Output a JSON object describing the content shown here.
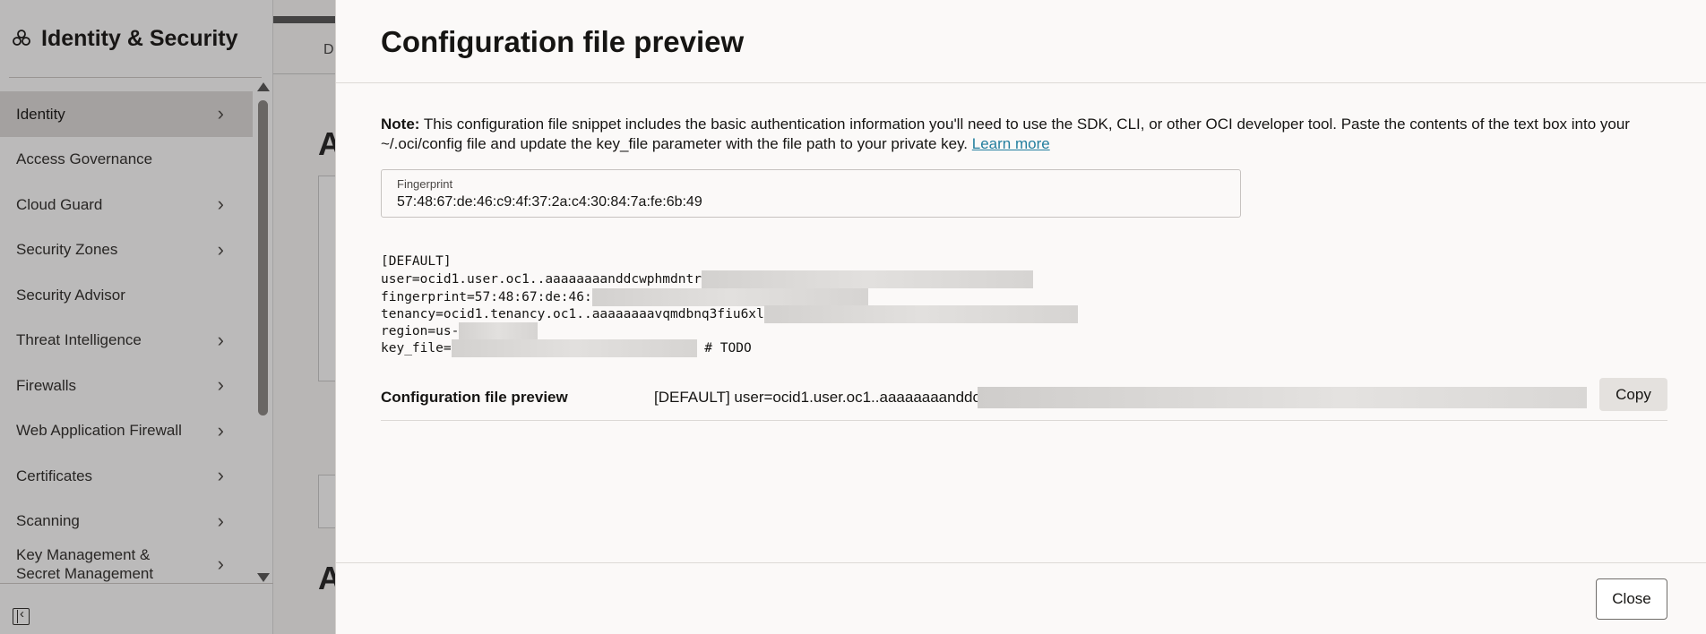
{
  "sidebar": {
    "title": "Identity & Security",
    "items": [
      {
        "label": "Identity",
        "has_children": true,
        "active": true
      },
      {
        "label": "Access Governance",
        "has_children": false
      },
      {
        "label": "Cloud Guard",
        "has_children": true
      },
      {
        "label": "Security Zones",
        "has_children": true
      },
      {
        "label": "Security Advisor",
        "has_children": false
      },
      {
        "label": "Threat Intelligence",
        "has_children": true
      },
      {
        "label": "Firewalls",
        "has_children": true
      },
      {
        "label": "Web Application Firewall",
        "has_children": true
      },
      {
        "label": "Certificates",
        "has_children": true
      },
      {
        "label": "Scanning",
        "has_children": true
      },
      {
        "label": "Key Management & Secret Management",
        "has_children": true
      }
    ]
  },
  "background": {
    "tab_label": "D",
    "heading_1": "A",
    "heading_2": "A"
  },
  "drawer": {
    "title": "Configuration file preview",
    "note": {
      "prefix": "Note:",
      "text": " This configuration file snippet includes the basic authentication information you'll need to use the SDK, CLI, or other OCI developer tool. Paste the contents of the text box into your ~/.oci/config file and update the key_file parameter with the file path to your private key. ",
      "link": "Learn more"
    },
    "fingerprint": {
      "label": "Fingerprint",
      "value": "57:48:67:de:46:c9:4f:37:2a:c4:30:84:7a:fe:6b:49"
    },
    "config_lines": {
      "section": "[DEFAULT]",
      "user": "user=ocid1.user.oc1..aaaaaaaanddcwphmdntr",
      "fingerprint": "fingerprint=57:48:67:de:46:",
      "tenancy": "tenancy=ocid1.tenancy.oc1..aaaaaaaavqmdbnq3fiu6xl",
      "region": "region=us-",
      "key_file": "key_file=",
      "key_file_comment": " # TODO"
    },
    "preview_row": {
      "label": "Configuration file preview",
      "value": "[DEFAULT] user=ocid1.user.oc1..aaaaaaaanddcv",
      "copy_label": "Copy"
    },
    "close_label": "Close"
  },
  "colors": {
    "link": "#227e9e",
    "scrim": "rgba(30,28,26,0.30)",
    "active_nav": "#dfdcda"
  }
}
